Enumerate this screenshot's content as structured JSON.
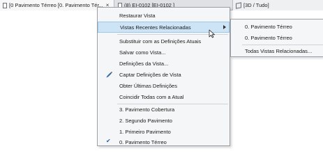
{
  "tabs": [
    {
      "label": "[0 Pavimento Térreo [0. Pavimento Tér...",
      "close": "×"
    },
    {
      "label": "(8) EI-0102 [EI-0102 ]"
    },
    {
      "label": "[3D / Tudo]"
    }
  ],
  "context_menu": {
    "items": {
      "restore": "Restaurar Vista",
      "recent": "Vistas Recentes Relacionadas",
      "replace": "Substituir com as Definições Atuais",
      "save_as": "Salvar como Vista...",
      "view_settings": "Definições da Vista...",
      "capture": "Captar Definições de Vista",
      "last_settings": "Obter Últimas Definições",
      "match_all": "Coincidir Todas com a Atual",
      "recent1": "3. Pavimento Cobertura",
      "recent2": "2. Segundo Pavimento",
      "recent3": "1. Primeiro Pavimento",
      "recent4": "0. Pavimento Térreo"
    },
    "checked_item": "0. Pavimento Térreo"
  },
  "submenu": {
    "items": [
      "0. Pavimento Térreo",
      "0. Pavimento Térreo"
    ],
    "all_related": "Todas Vistas Relacionadas..."
  },
  "colors": {
    "highlight": "#cde3f6",
    "menu_bg": "#f5f6f7",
    "tab_bar": "#dfe1e5"
  }
}
